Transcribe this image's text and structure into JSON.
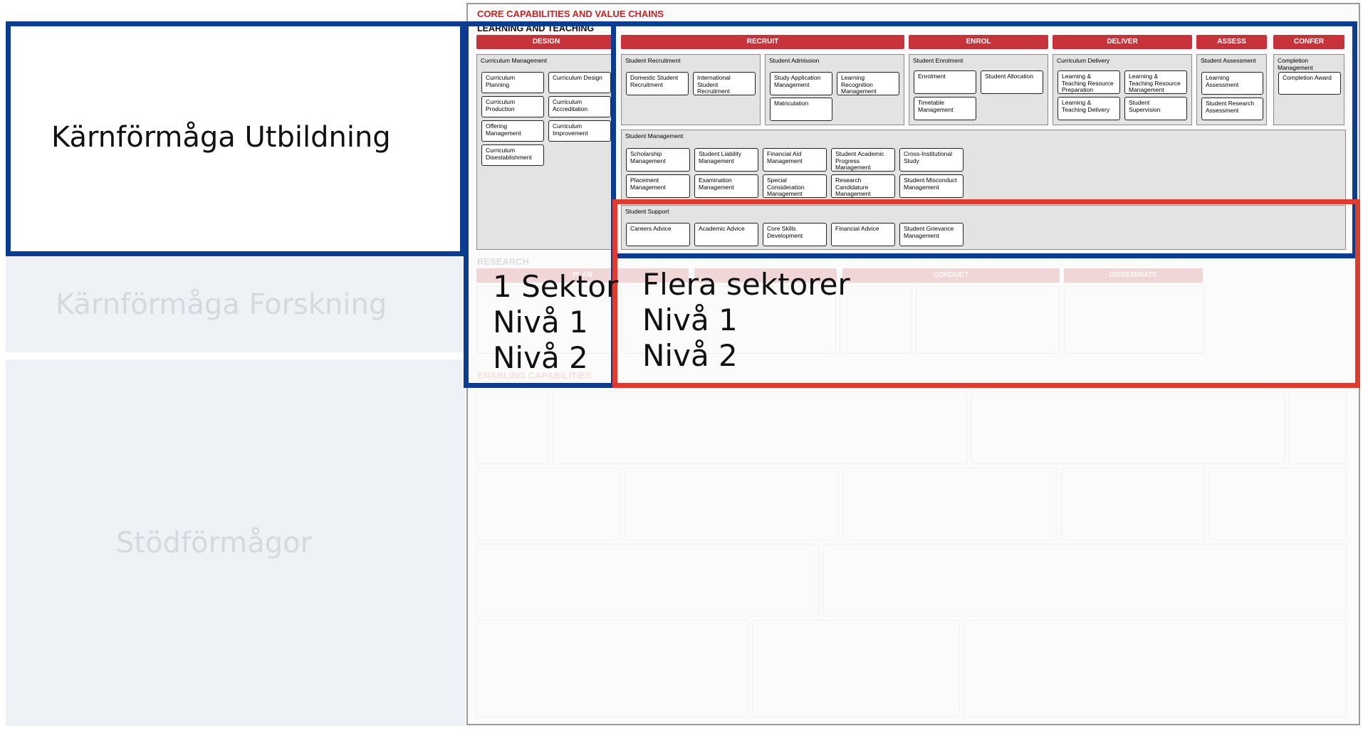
{
  "labels": {
    "teaching": "Kärnförmåga Utbildning",
    "research": "Kärnförmåga Forskning",
    "enabling": "Stödförmågor"
  },
  "overlay": {
    "left_line1": "1 Sektor",
    "left_line2": "Nivå 1",
    "left_line3": "Nivå 2",
    "right_line1": "Flera  sektorer",
    "right_line2": "Nivå 1",
    "right_line3": "Nivå 2"
  },
  "map": {
    "title": "CORE CAPABILITIES AND VALUE CHAINS",
    "teaching_title": "LEARNING AND TEACHING",
    "research_title": "RESEARCH",
    "enabling_title": "ENABLING CAPABILITIES",
    "chain": [
      "DESIGN",
      "RECRUIT",
      "ENROL",
      "DELIVER",
      "ASSESS",
      "CONFER"
    ],
    "research_chain": [
      "PLAN",
      "",
      "CONDUCT",
      "DISSEMINATE"
    ],
    "groups": {
      "curriculum_management": "Curriculum Management",
      "student_recruitment": "Student Recruitment",
      "student_admission": "Student Admission",
      "student_enrolment": "Student Enrolment",
      "curriculum_delivery": "Curriculum Delivery",
      "student_assessment": "Student Assessment",
      "completion_management": "Completion Management",
      "student_management": "Student Management",
      "student_support": "Student Support"
    },
    "caps": {
      "curriculum_planning": "Curriculum Planning",
      "curriculum_design": "Curriculum Design",
      "curriculum_production": "Curriculum Production",
      "curriculum_accreditation": "Curriculum Accreditation",
      "offering_management": "Offering Management",
      "curriculum_improvement": "Curriculum Improvement",
      "curriculum_disestablishment": "Curriculum Disestablishment",
      "domestic_student_recruitment": "Domestic Student Recruitment",
      "international_student_recruitment": "International Student Recruitment",
      "study_application_management": "Study Application Management",
      "learning_recognition_management": "Learning Recognition Management",
      "matriculation": "Matriculation",
      "enrolment": "Enrolment",
      "student_allocation": "Student Allocation",
      "timetable_management": "Timetable Management",
      "lt_resource_preparation": "Learning & Teaching Resource Preparation",
      "lt_resource_management": "Learning & Teaching Resource Management",
      "lt_delivery": "Learning & Teaching Delivery",
      "student_supervision": "Student Supervision",
      "learning_assessment": "Learning Assessment",
      "student_research_assessment": "Student Research Assessment",
      "completion_award": "Completion Award",
      "scholarship_management": "Scholarship Management",
      "student_liability_management": "Student Liability Management",
      "financial_aid_management": "Financial Aid Management",
      "student_academic_progress_management": "Student Academic Progress Management",
      "cross_institutional_study": "Cross-Institutional Study",
      "placement_management": "Placement Management",
      "examination_management": "Examination Management",
      "special_consideration_management": "Special Consideration Management",
      "research_candidature_management": "Research Candidature Management",
      "student_misconduct_management": "Student Misconduct Management",
      "careers_advice": "Careers Advice",
      "academic_advice": "Academic Advice",
      "core_skills_development": "Core Skills Development",
      "financial_advice": "Financial Advice",
      "student_grievance_management": "Student Grievance Management"
    }
  },
  "colors": {
    "blue": "#0a3d8f",
    "red": "#e03b2d",
    "chain_red": "#c8323a",
    "title_red": "#cc2222"
  }
}
